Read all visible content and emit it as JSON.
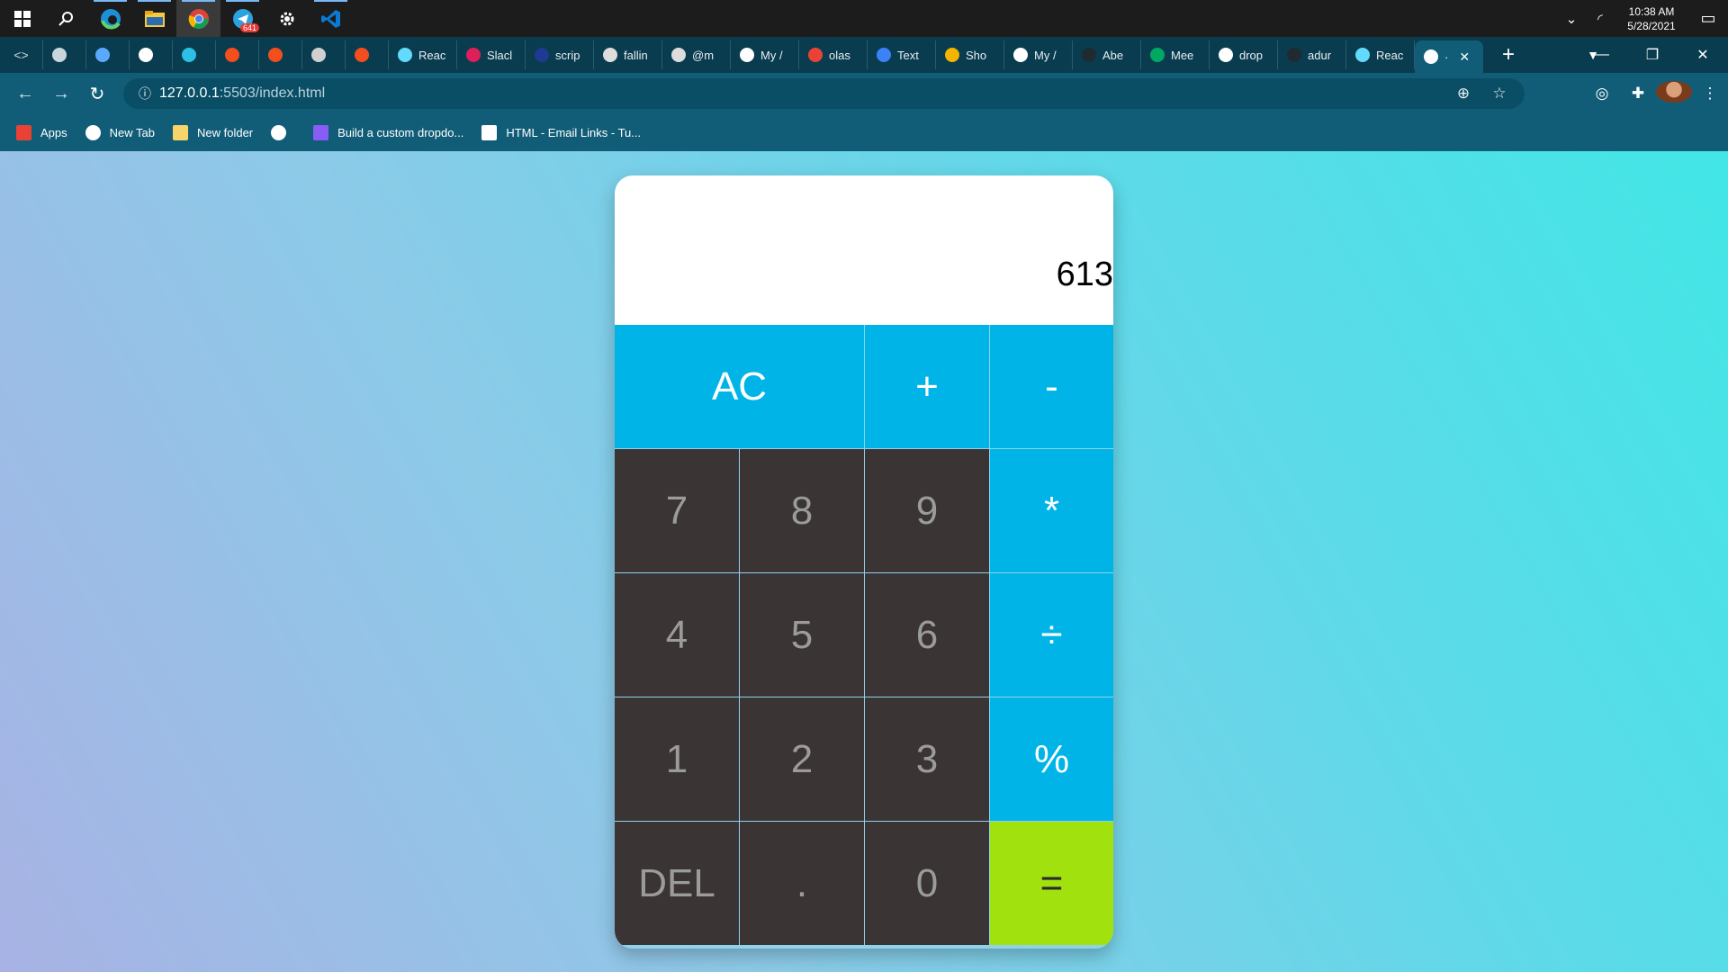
{
  "taskbar": {
    "apps": [
      "windows-start-icon",
      "search-icon",
      "edge-icon",
      "file-explorer-icon",
      "chrome-icon",
      "telegram-icon",
      "settings-icon",
      "vscode-icon"
    ],
    "telegram_badge": "641",
    "clock_time": "10:38 AM",
    "clock_date": "5/28/2021",
    "notification_count": "1"
  },
  "tabs": {
    "items": [
      {
        "label": "",
        "color": "#c9d7dd"
      },
      {
        "label": "",
        "color": "#5aa9ff"
      },
      {
        "label": "",
        "color": "#ffffff"
      },
      {
        "label": "",
        "color": "#2bc0e4"
      },
      {
        "label": "",
        "color": "#f24e1e"
      },
      {
        "label": "",
        "color": "#f24e1e"
      },
      {
        "label": "",
        "color": "#d0d0d0"
      },
      {
        "label": "",
        "color": "#f24e1e"
      },
      {
        "label": "Reac",
        "color": "#61dafb"
      },
      {
        "label": "Slacl",
        "color": "#e01e5a"
      },
      {
        "label": "scrip",
        "color": "#1f3a93"
      },
      {
        "label": "fallin",
        "color": "#dddddd"
      },
      {
        "label": "@m",
        "color": "#dddddd"
      },
      {
        "label": "My /",
        "color": "#ffffff"
      },
      {
        "label": "olas",
        "color": "#ea4335"
      },
      {
        "label": "Text",
        "color": "#3b82f6"
      },
      {
        "label": "Sho",
        "color": "#f4b400"
      },
      {
        "label": "My /",
        "color": "#ffffff"
      },
      {
        "label": "Abe",
        "color": "#1f2b30"
      },
      {
        "label": "Mee",
        "color": "#00a862"
      },
      {
        "label": "drop",
        "color": "#ffffff"
      },
      {
        "label": "adur",
        "color": "#1f2b30"
      },
      {
        "label": "Reac",
        "color": "#61dafb"
      }
    ],
    "active_label": "·"
  },
  "address_bar": {
    "url_host": "127.0.0.1",
    "url_path": ":5503/index.html"
  },
  "bookmarks": [
    {
      "label": "Apps",
      "icon": "apps-grid-icon",
      "color": "#e94235"
    },
    {
      "label": "New Tab",
      "icon": "globe-icon",
      "color": "#ffffff"
    },
    {
      "label": "New folder",
      "icon": "folder-icon",
      "color": "#f6d36b"
    },
    {
      "label": "",
      "icon": "globe-icon",
      "color": "#ffffff"
    },
    {
      "label": "Build a custom dropdo...",
      "icon": "bookmark-purple-icon",
      "color": "#8a5cf6"
    },
    {
      "label": "HTML - Email Links - Tu...",
      "icon": "tutorial-icon",
      "color": "#ffffff"
    }
  ],
  "calculator": {
    "display": "613",
    "keys": [
      {
        "label": "AC",
        "type": "op",
        "wide": true,
        "name": "clear-button"
      },
      {
        "label": "+",
        "type": "op",
        "name": "plus-button"
      },
      {
        "label": "-",
        "type": "op",
        "name": "minus-button"
      },
      {
        "label": "7",
        "type": "num",
        "name": "digit-7-button"
      },
      {
        "label": "8",
        "type": "num",
        "name": "digit-8-button"
      },
      {
        "label": "9",
        "type": "num",
        "name": "digit-9-button"
      },
      {
        "label": "*",
        "type": "op",
        "name": "multiply-button"
      },
      {
        "label": "4",
        "type": "num",
        "name": "digit-4-button"
      },
      {
        "label": "5",
        "type": "num",
        "name": "digit-5-button"
      },
      {
        "label": "6",
        "type": "num",
        "name": "digit-6-button"
      },
      {
        "label": "÷",
        "type": "op",
        "name": "divide-button"
      },
      {
        "label": "1",
        "type": "num",
        "name": "digit-1-button"
      },
      {
        "label": "2",
        "type": "num",
        "name": "digit-2-button"
      },
      {
        "label": "3",
        "type": "num",
        "name": "digit-3-button"
      },
      {
        "label": "%",
        "type": "op",
        "name": "percent-button"
      },
      {
        "label": "DEL",
        "type": "num",
        "name": "delete-button"
      },
      {
        "label": ".",
        "type": "num",
        "name": "decimal-button"
      },
      {
        "label": "0",
        "type": "num",
        "name": "digit-0-button"
      },
      {
        "label": "=",
        "type": "eq",
        "name": "equals-button"
      }
    ],
    "colors": {
      "operator": "#00b4e8",
      "number": "#3a3434",
      "equals": "#a0e10e"
    }
  }
}
